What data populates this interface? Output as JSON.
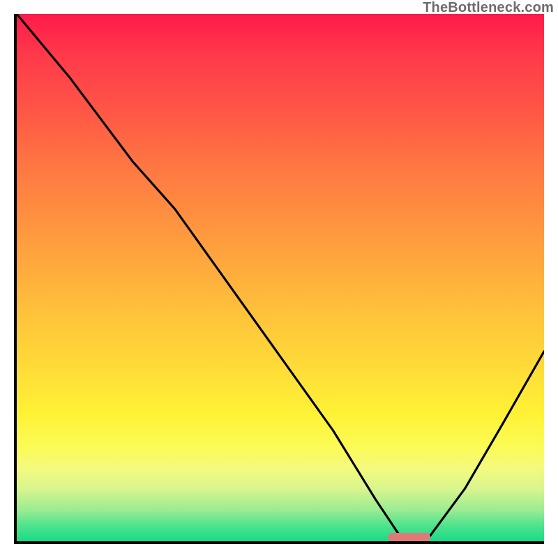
{
  "watermark": "TheBottleneck.com",
  "chart_data": {
    "type": "line",
    "title": "",
    "xlabel": "",
    "ylabel": "",
    "xlim": [
      0,
      100
    ],
    "ylim": [
      0,
      100
    ],
    "grid": false,
    "legend": false,
    "background": "heatmap-gradient",
    "annotations": [
      {
        "kind": "marker-pill",
        "x_start": 70,
        "x_end": 78,
        "y": 0,
        "color": "#e07a78"
      }
    ],
    "series": [
      {
        "name": "bottleneck-curve",
        "color": "#000000",
        "x": [
          0,
          10,
          22,
          30,
          40,
          50,
          60,
          68,
          73,
          78,
          85,
          92,
          100
        ],
        "y": [
          100,
          88,
          72,
          63,
          49,
          35,
          21,
          8,
          0.5,
          0.5,
          10,
          22,
          36
        ]
      }
    ]
  }
}
